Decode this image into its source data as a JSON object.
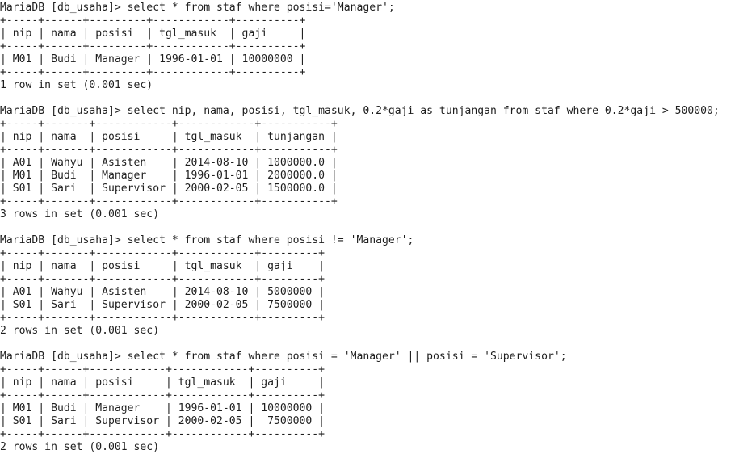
{
  "terminal": {
    "lines": [
      "MariaDB [db_usaha]> select * from staf where posisi='Manager';",
      "+-----+------+---------+------------+----------+",
      "| nip | nama | posisi  | tgl_masuk  | gaji     |",
      "+-----+------+---------+------------+----------+",
      "| M01 | Budi | Manager | 1996-01-01 | 10000000 |",
      "+-----+------+---------+------------+----------+",
      "1 row in set (0.001 sec)",
      "",
      "MariaDB [db_usaha]> select nip, nama, posisi, tgl_masuk, 0.2*gaji as tunjangan from staf where 0.2*gaji > 500000;",
      "+-----+-------+------------+------------+-----------+",
      "| nip | nama  | posisi     | tgl_masuk  | tunjangan |",
      "+-----+-------+------------+------------+-----------+",
      "| A01 | Wahyu | Asisten    | 2014-08-10 | 1000000.0 |",
      "| M01 | Budi  | Manager    | 1996-01-01 | 2000000.0 |",
      "| S01 | Sari  | Supervisor | 2000-02-05 | 1500000.0 |",
      "+-----+-------+------------+------------+-----------+",
      "3 rows in set (0.001 sec)",
      "",
      "MariaDB [db_usaha]> select * from staf where posisi != 'Manager';",
      "+-----+-------+------------+------------+---------+",
      "| nip | nama  | posisi     | tgl_masuk  | gaji    |",
      "+-----+-------+------------+------------+---------+",
      "| A01 | Wahyu | Asisten    | 2014-08-10 | 5000000 |",
      "| S01 | Sari  | Supervisor | 2000-02-05 | 7500000 |",
      "+-----+-------+------------+------------+---------+",
      "2 rows in set (0.001 sec)",
      "",
      "MariaDB [db_usaha]> select * from staf where posisi = 'Manager' || posisi = 'Supervisor';",
      "+-----+------+------------+------------+----------+",
      "| nip | nama | posisi     | tgl_masuk  | gaji     |",
      "+-----+------+------------+------------+----------+",
      "| M01 | Budi | Manager    | 1996-01-01 | 10000000 |",
      "| S01 | Sari | Supervisor | 2000-02-05 |  7500000 |",
      "+-----+------+------------+------------+----------+",
      "2 rows in set (0.001 sec)"
    ]
  }
}
